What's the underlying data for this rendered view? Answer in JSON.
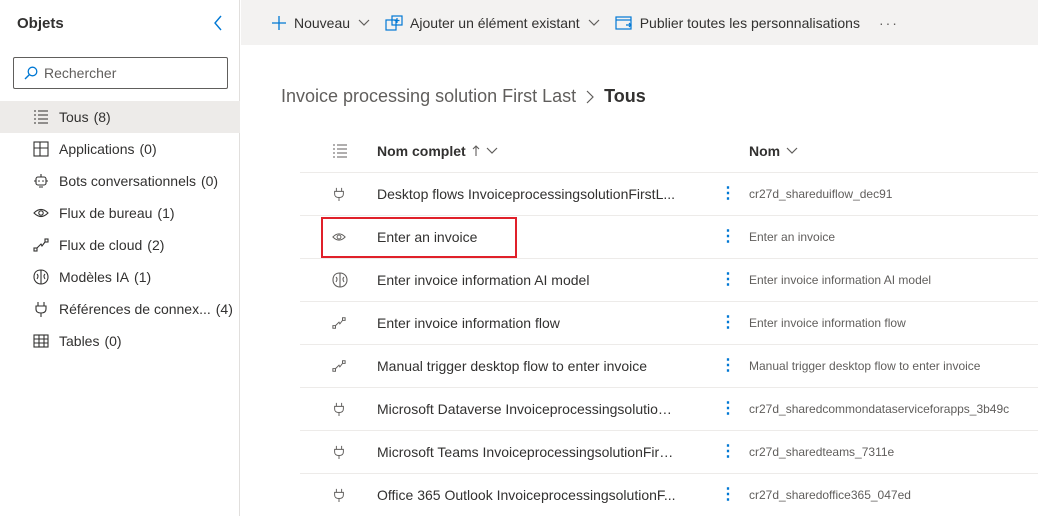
{
  "sidebar": {
    "title": "Objets",
    "search_placeholder": "Rechercher",
    "items": [
      {
        "label": "Tous",
        "count": "(8)",
        "icon": "list-icon",
        "active": true
      },
      {
        "label": "Applications",
        "count": "(0)",
        "icon": "apps-icon"
      },
      {
        "label": "Bots conversationnels",
        "count": "(0)",
        "icon": "bot-icon"
      },
      {
        "label": "Flux de bureau",
        "count": "(1)",
        "icon": "desktop-flow-icon"
      },
      {
        "label": "Flux de cloud",
        "count": "(2)",
        "icon": "cloud-flow-icon"
      },
      {
        "label": "Modèles IA",
        "count": "(1)",
        "icon": "ai-model-icon"
      },
      {
        "label": "Références de connex...",
        "count": "(4)",
        "icon": "connector-icon"
      },
      {
        "label": "Tables",
        "count": "(0)",
        "icon": "table-icon"
      }
    ]
  },
  "toolbar": {
    "new_label": "Nouveau",
    "add_existing_label": "Ajouter un élément existant",
    "publish_label": "Publier toutes les personnalisations",
    "more_label": "···"
  },
  "breadcrumb": {
    "parent": "Invoice processing solution First Last",
    "current": "Tous"
  },
  "grid": {
    "col_display_name": "Nom complet",
    "col_name": "Nom",
    "rows": [
      {
        "display": "Desktop flows InvoiceprocessingsolutionFirstL...",
        "name": "cr27d_shareduiflow_dec91",
        "icon": "connector-icon"
      },
      {
        "display": "Enter an invoice",
        "name": "Enter an invoice",
        "icon": "desktop-flow-icon"
      },
      {
        "display": "Enter invoice information AI model",
        "name": "Enter invoice information AI model",
        "icon": "ai-model-icon"
      },
      {
        "display": "Enter invoice information flow",
        "name": "Enter invoice information flow",
        "icon": "cloud-flow-icon"
      },
      {
        "display": "Manual trigger desktop flow to enter invoice",
        "name": "Manual trigger desktop flow to enter invoice",
        "icon": "cloud-flow-icon"
      },
      {
        "display": "Microsoft Dataverse Invoiceprocessingsolution...",
        "name": "cr27d_sharedcommondataserviceforapps_3b49c",
        "icon": "connector-icon"
      },
      {
        "display": "Microsoft Teams InvoiceprocessingsolutionFirs...",
        "name": "cr27d_sharedteams_7311e",
        "icon": "connector-icon"
      },
      {
        "display": "Office 365 Outlook InvoiceprocessingsolutionF...",
        "name": "cr27d_sharedoffice365_047ed",
        "icon": "connector-icon"
      }
    ]
  },
  "colors": {
    "accent": "#0078d4",
    "highlight": "#e0202a"
  }
}
